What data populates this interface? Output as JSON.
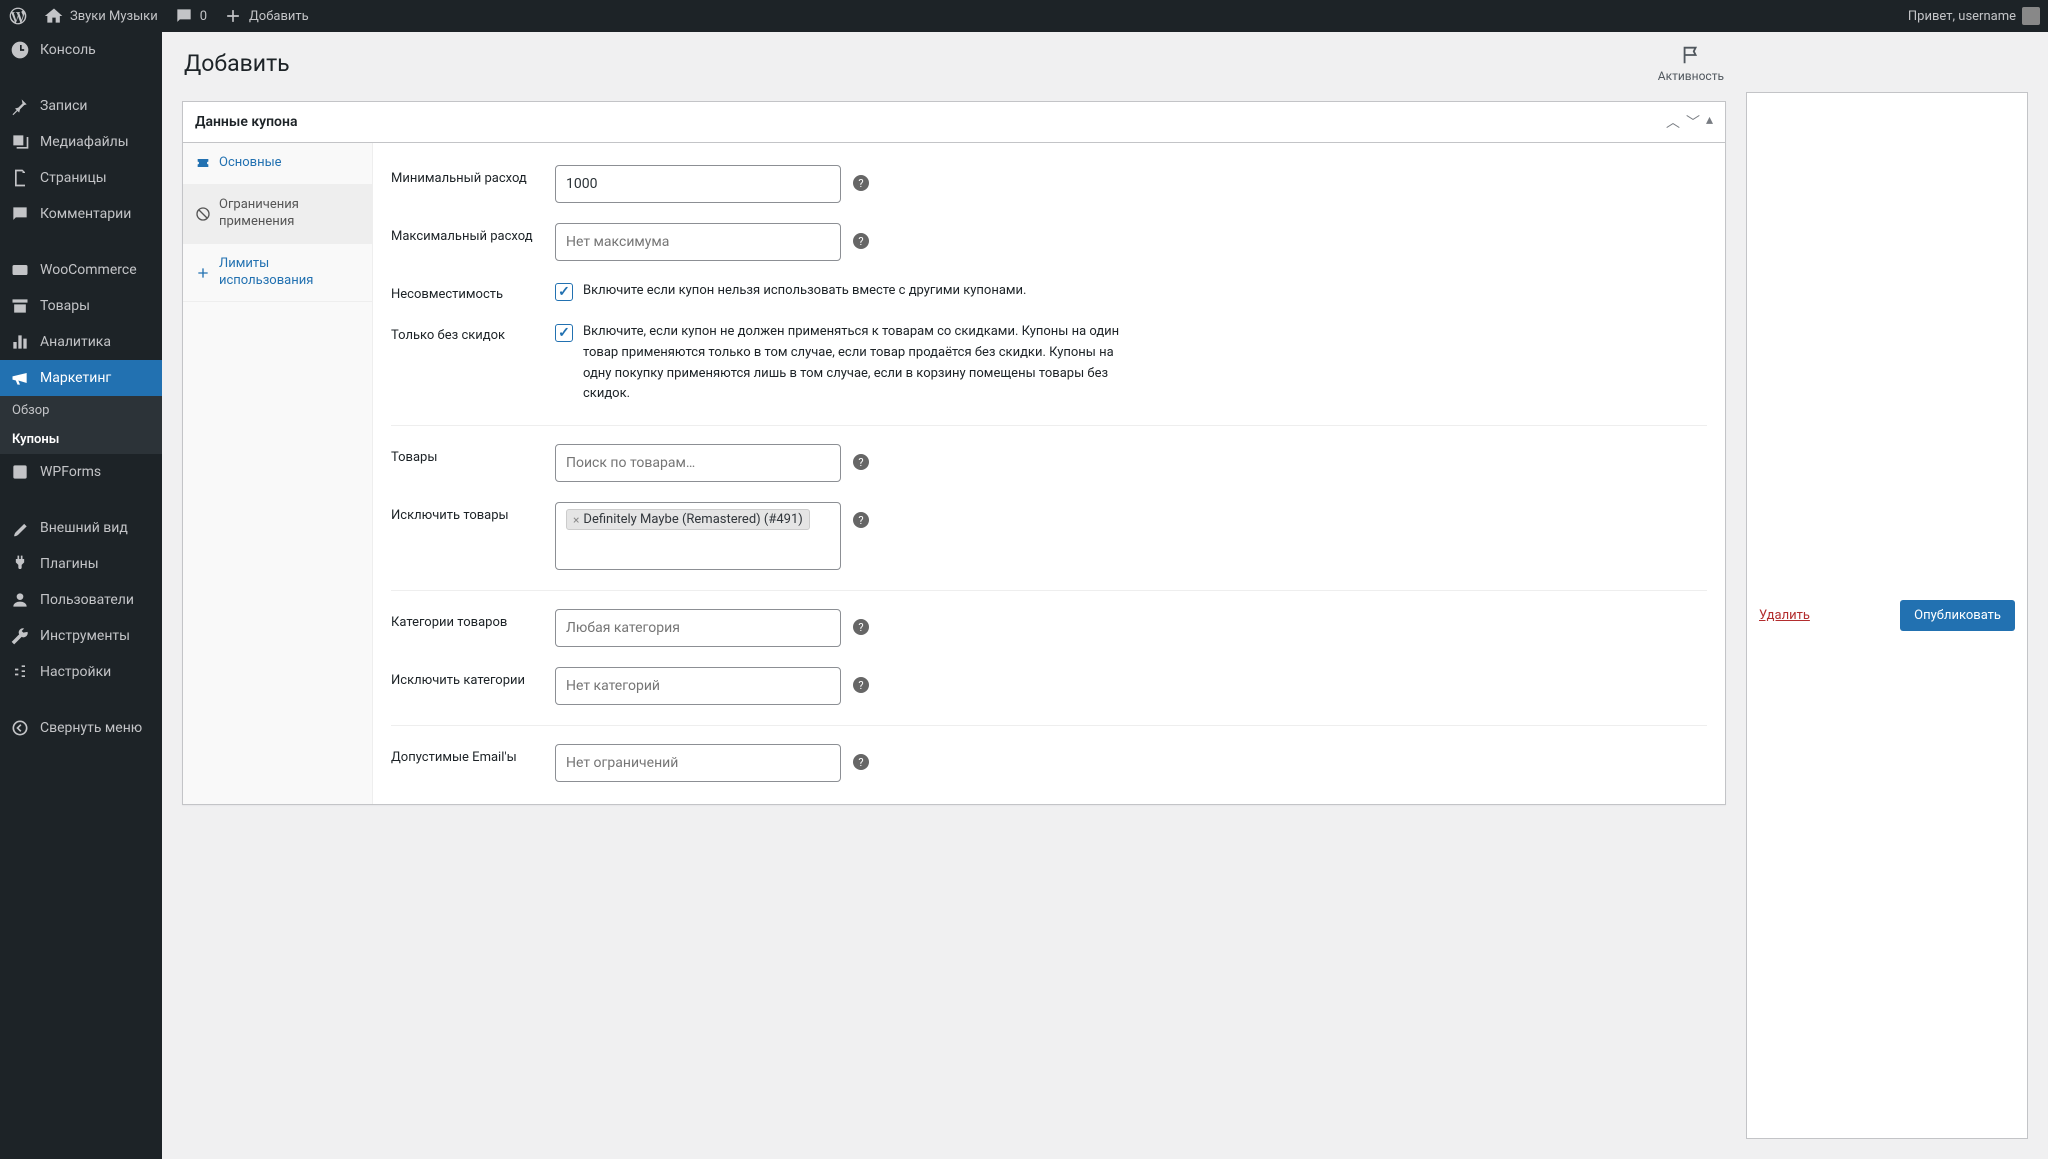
{
  "topbar": {
    "site_name": "Звуки Музыки",
    "comments": "0",
    "add_new": "Добавить",
    "greeting": "Привет, username"
  },
  "sidebar": {
    "console": "Консоль",
    "posts": "Записи",
    "media": "Медиафайлы",
    "pages": "Страницы",
    "comments": "Комментарии",
    "woocommerce": "WooCommerce",
    "products": "Товары",
    "analytics": "Аналитика",
    "marketing": "Маркетинг",
    "marketing_sub": {
      "overview": "Обзор",
      "coupons": "Купоны"
    },
    "wpforms": "WPForms",
    "appearance": "Внешний вид",
    "plugins": "Плагины",
    "users": "Пользователи",
    "tools": "Инструменты",
    "settings": "Настройки",
    "collapse": "Свернуть меню"
  },
  "header": {
    "title": "Добавить",
    "activity": "Активность"
  },
  "panel": {
    "title": "Данные купона",
    "tabs": {
      "general": "Основные",
      "restrictions": "Ограничения применения",
      "limits": "Лимиты использования"
    }
  },
  "form": {
    "min_spend": {
      "label": "Минимальный расход",
      "value": "1000"
    },
    "max_spend": {
      "label": "Максимальный расход",
      "placeholder": "Нет максимума"
    },
    "incompat": {
      "label": "Несовместимость",
      "text": "Включите если купон нельзя использовать вместе с другими купонами."
    },
    "sale_only": {
      "label": "Только без скидок",
      "text": "Включите, если купон не должен применяться к товарам со скидками. Купоны на один товар применяются только в том случае, если товар продаётся без скидки. Купоны на одну покупку применяются лишь в том случае, если в корзину помещены товары без скидок."
    },
    "products": {
      "label": "Товары",
      "placeholder": "Поиск по товарам…"
    },
    "exclude_products": {
      "label": "Исключить товары",
      "tag": "Definitely Maybe (Remastered) (#491)"
    },
    "categories": {
      "label": "Категории товаров",
      "placeholder": "Любая категория"
    },
    "exclude_categories": {
      "label": "Исключить категории",
      "placeholder": "Нет категорий"
    },
    "emails": {
      "label": "Допустимые Email'ы",
      "placeholder": "Нет ограничений"
    }
  },
  "publish": {
    "delete": "Удалить",
    "publish": "Опубликовать"
  }
}
